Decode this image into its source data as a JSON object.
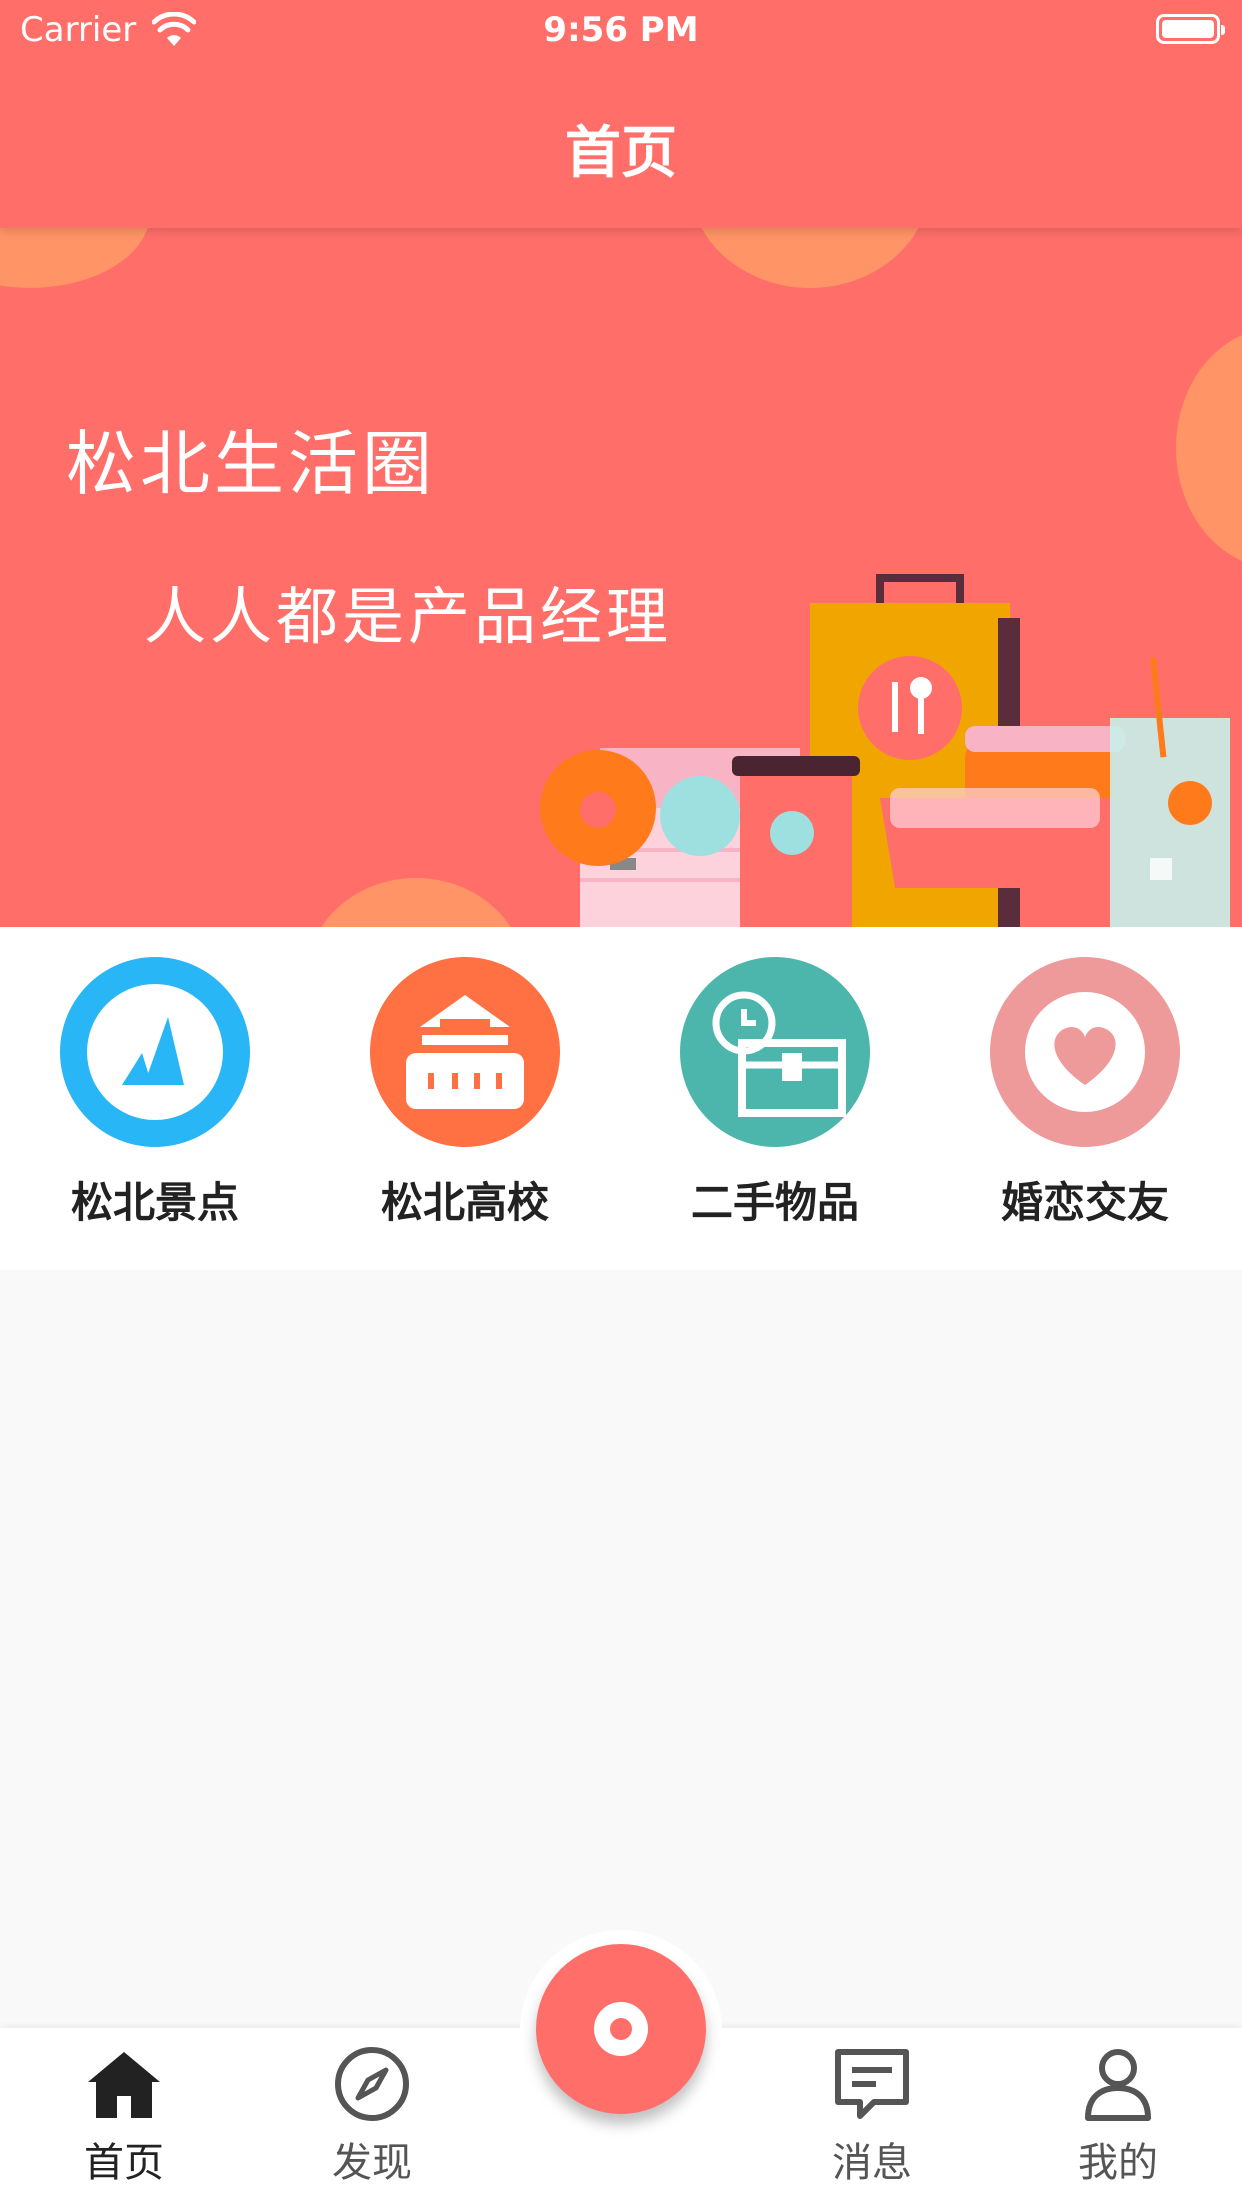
{
  "status": {
    "carrier": "Carrier",
    "time": "9:56 PM"
  },
  "nav": {
    "title": "首页"
  },
  "banner": {
    "title": "松北生活圈",
    "subtitle": "人人都是产品经理"
  },
  "categories": [
    {
      "label": "松北景点",
      "color": "#29b6f6",
      "icon": "mountain-icon"
    },
    {
      "label": "松北高校",
      "color": "#ff7043",
      "icon": "school-icon"
    },
    {
      "label": "二手物品",
      "color": "#4db6ac",
      "icon": "box-clock-icon"
    },
    {
      "label": "婚恋交友",
      "color": "#ef9a9a",
      "icon": "heart-icon"
    }
  ],
  "tabs": [
    {
      "label": "首页",
      "icon": "home-icon",
      "active": true
    },
    {
      "label": "发现",
      "icon": "compass-icon",
      "active": false
    },
    {
      "label": "消息",
      "icon": "message-icon",
      "active": false
    },
    {
      "label": "我的",
      "icon": "user-icon",
      "active": false
    }
  ],
  "fab": {
    "icon": "record-icon"
  },
  "colors": {
    "primary": "#ff6e69",
    "accent": "#ff9466",
    "background": "#f9f9f9"
  }
}
